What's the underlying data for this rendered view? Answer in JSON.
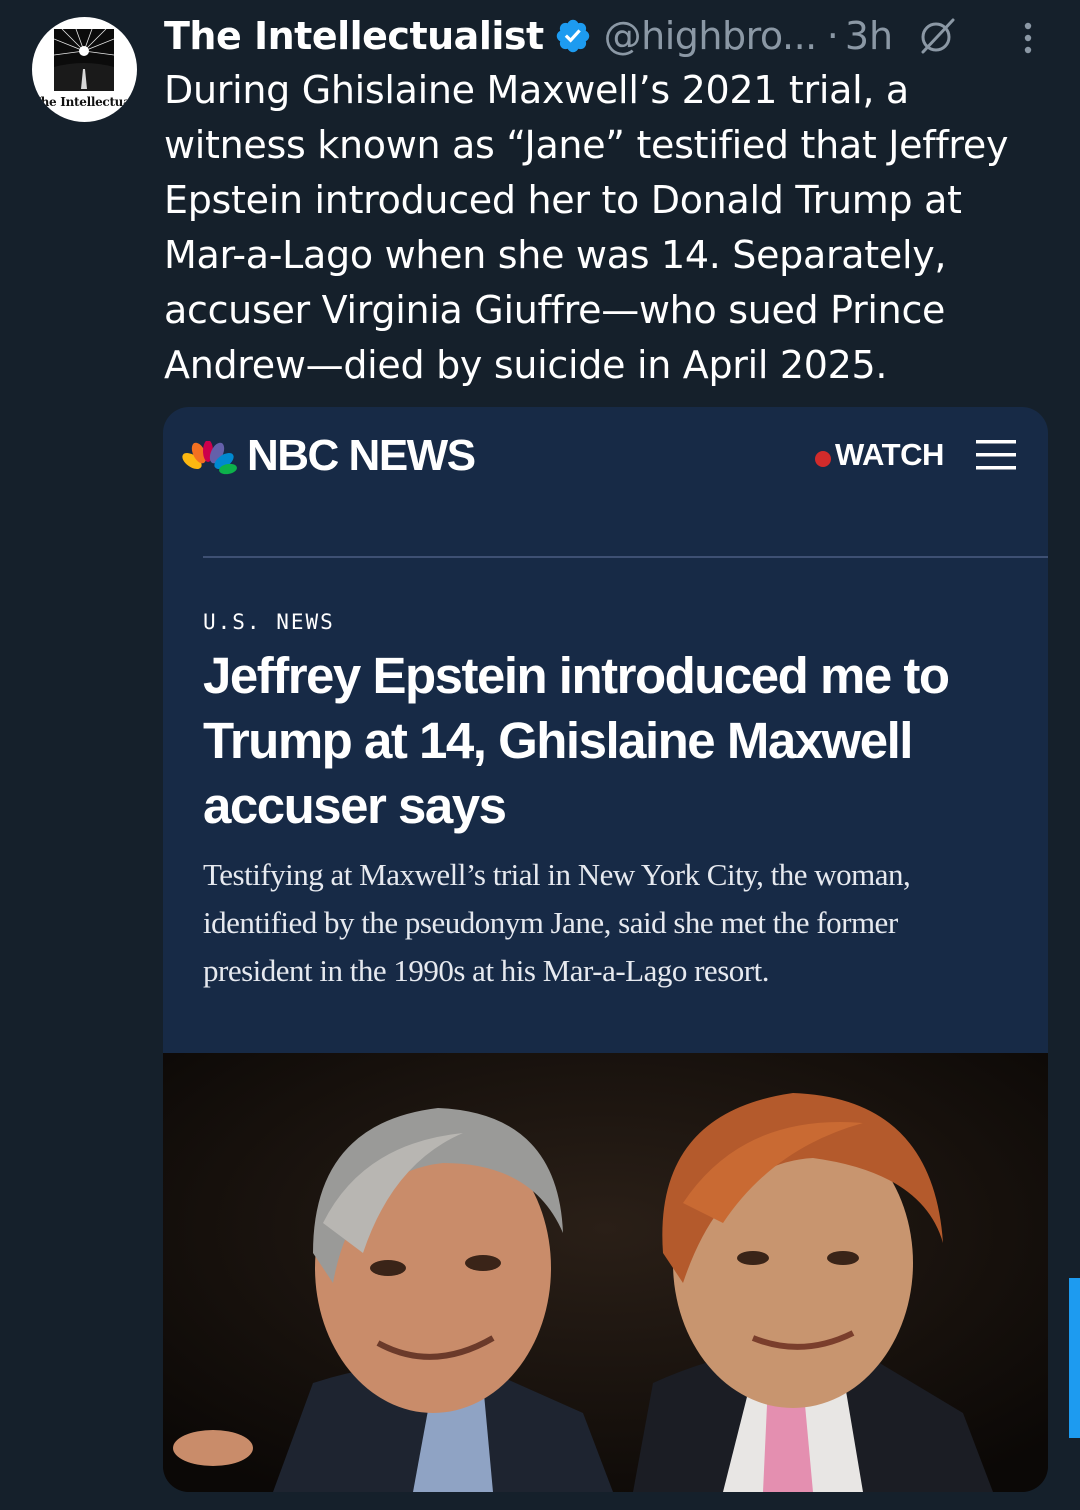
{
  "tweet": {
    "avatar_text": "The Intellectualist",
    "author_name": "The Intellectualist",
    "handle": "@highbro...",
    "separator": "·",
    "time": "3h",
    "text_lines": [
      "During Ghislaine Maxwell’s 2021 trial, a",
      "witness known as “Jane” testified that Jeffrey",
      "Epstein introduced her to Donald Trump at",
      "Mar-a-Lago when she was 14. Separately,",
      "accuser Virginia Giuffre—who sued Prince",
      "Andrew—died by suicide in April 2025."
    ],
    "icons": [
      "verified-badge-icon",
      "grok-icon",
      "more-options-icon"
    ]
  },
  "card": {
    "brand": "NBC NEWS",
    "watch_label": "WATCH",
    "section": "U.S. NEWS",
    "headline_lines": [
      "Jeffrey Epstein introduced me to",
      "Trump at 14, Ghislaine Maxwell",
      "accuser says"
    ],
    "dek_lines": [
      "Testifying at Maxwell’s trial in New York City, the woman,",
      "identified by the pseudonym Jane, said she met the former",
      "president in the 1990s at his Mar-a-Lago resort."
    ],
    "icons": [
      "nbc-peacock-icon",
      "hamburger-menu-icon"
    ]
  },
  "colors": {
    "background": "#15202b",
    "card_background": "#172a46",
    "verified_blue": "#1d9bf0",
    "muted_text": "#8b98a5",
    "live_red": "#d12b2b"
  }
}
